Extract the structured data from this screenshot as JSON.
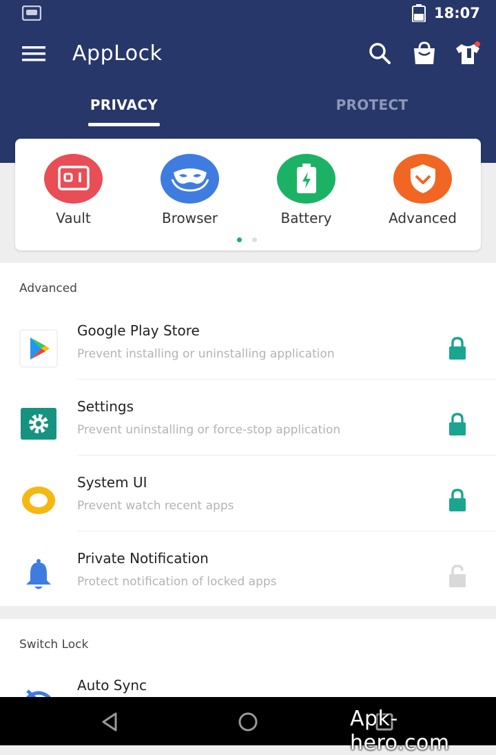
{
  "status_bar": {
    "time": "18:07"
  },
  "header": {
    "title": "AppLock"
  },
  "tabs": [
    {
      "label": "PRIVACY",
      "active": true
    },
    {
      "label": "PROTECT",
      "active": false
    }
  ],
  "shortcuts": [
    {
      "label": "Vault",
      "color": "#e94d55",
      "icon": "safe-icon"
    },
    {
      "label": "Browser",
      "color": "#3f7ce0",
      "icon": "mask-icon"
    },
    {
      "label": "Battery",
      "color": "#1cb266",
      "icon": "battery-icon"
    },
    {
      "label": "Advanced",
      "color": "#f16623",
      "icon": "shield-icon"
    }
  ],
  "pager": {
    "current": 1,
    "total": 2
  },
  "advanced": {
    "title": "Advanced",
    "items": [
      {
        "title": "Google Play Store",
        "subtitle": "Prevent installing or uninstalling application",
        "locked": true
      },
      {
        "title": "Settings",
        "subtitle": "Prevent uninstalling or force-stop application",
        "locked": true
      },
      {
        "title": "System UI",
        "subtitle": "Prevent watch recent apps",
        "locked": true
      },
      {
        "title": "Private Notification",
        "subtitle": "Protect notification of locked apps",
        "locked": false
      }
    ]
  },
  "switch_lock": {
    "title": "Switch Lock",
    "items": [
      {
        "title": "Auto Sync"
      }
    ]
  },
  "colors": {
    "header": "#28376a",
    "accent": "#1aa591",
    "lock_off": "#d9d9d9"
  },
  "watermark": "Apk-hero.com"
}
